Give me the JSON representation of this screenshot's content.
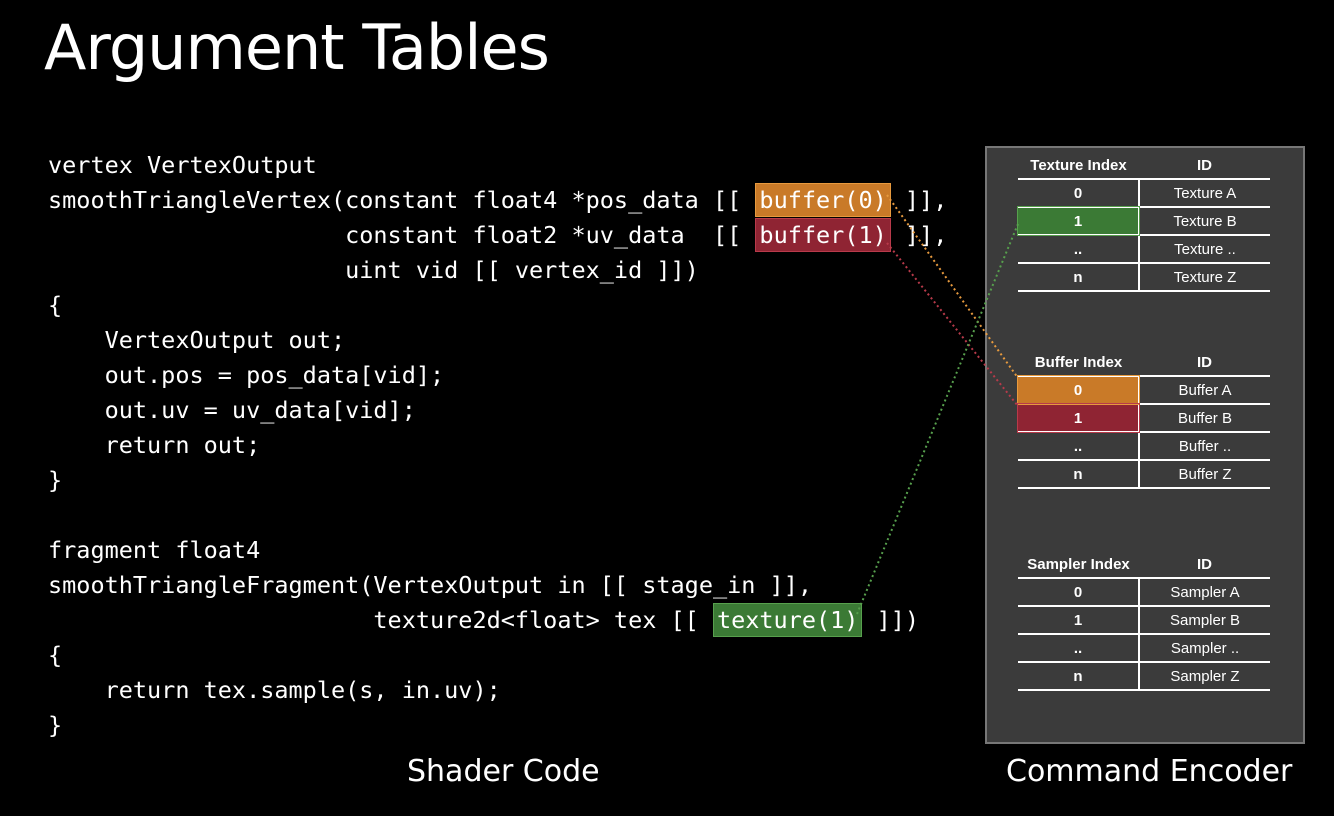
{
  "title": "Argument Tables",
  "code": {
    "l1": "vertex VertexOutput",
    "l2a": "smoothTriangleVertex(constant float4 *pos_data [[ ",
    "l2b": "buffer(0)",
    "l2c": " ]],",
    "l3a": "                     constant float2 *uv_data  [[ ",
    "l3b": "buffer(1)",
    "l3c": " ]],",
    "l4": "                     uint vid [[ vertex_id ]])",
    "l5": "{",
    "l6": "    VertexOutput out;",
    "l7": "    out.pos = pos_data[vid];",
    "l8": "    out.uv = uv_data[vid];",
    "l9": "    return out;",
    "l10": "}",
    "l11": "fragment float4",
    "l12": "smoothTriangleFragment(VertexOutput in [[ stage_in ]],",
    "l13a": "                       texture2d<float> tex [[ ",
    "l13b": "texture(1)",
    "l13c": " ]])",
    "l14": "{",
    "l15": "    return tex.sample(s, in.uv);",
    "l16": "}"
  },
  "captions": {
    "shader": "Shader Code",
    "encoder": "Command Encoder"
  },
  "tables": {
    "texture": {
      "header_index": "Texture Index",
      "header_id": "ID",
      "rows": [
        {
          "index": "0",
          "id": "Texture A"
        },
        {
          "index": "1",
          "id": "Texture B"
        },
        {
          "index": "..",
          "id": "Texture .."
        },
        {
          "index": "n",
          "id": "Texture Z"
        }
      ]
    },
    "buffer": {
      "header_index": "Buffer Index",
      "header_id": "ID",
      "rows": [
        {
          "index": "0",
          "id": "Buffer A"
        },
        {
          "index": "1",
          "id": "Buffer B"
        },
        {
          "index": "..",
          "id": "Buffer .."
        },
        {
          "index": "n",
          "id": "Buffer Z"
        }
      ]
    },
    "sampler": {
      "header_index": "Sampler Index",
      "header_id": "ID",
      "rows": [
        {
          "index": "0",
          "id": "Sampler A"
        },
        {
          "index": "1",
          "id": "Sampler B"
        },
        {
          "index": "..",
          "id": "Sampler .."
        },
        {
          "index": "n",
          "id": "Sampler Z"
        }
      ]
    }
  },
  "colors": {
    "buffer0": "#c97a28",
    "buffer1": "#8f2433",
    "texture1": "#3b7a35",
    "panel": "#3b3b3b"
  }
}
